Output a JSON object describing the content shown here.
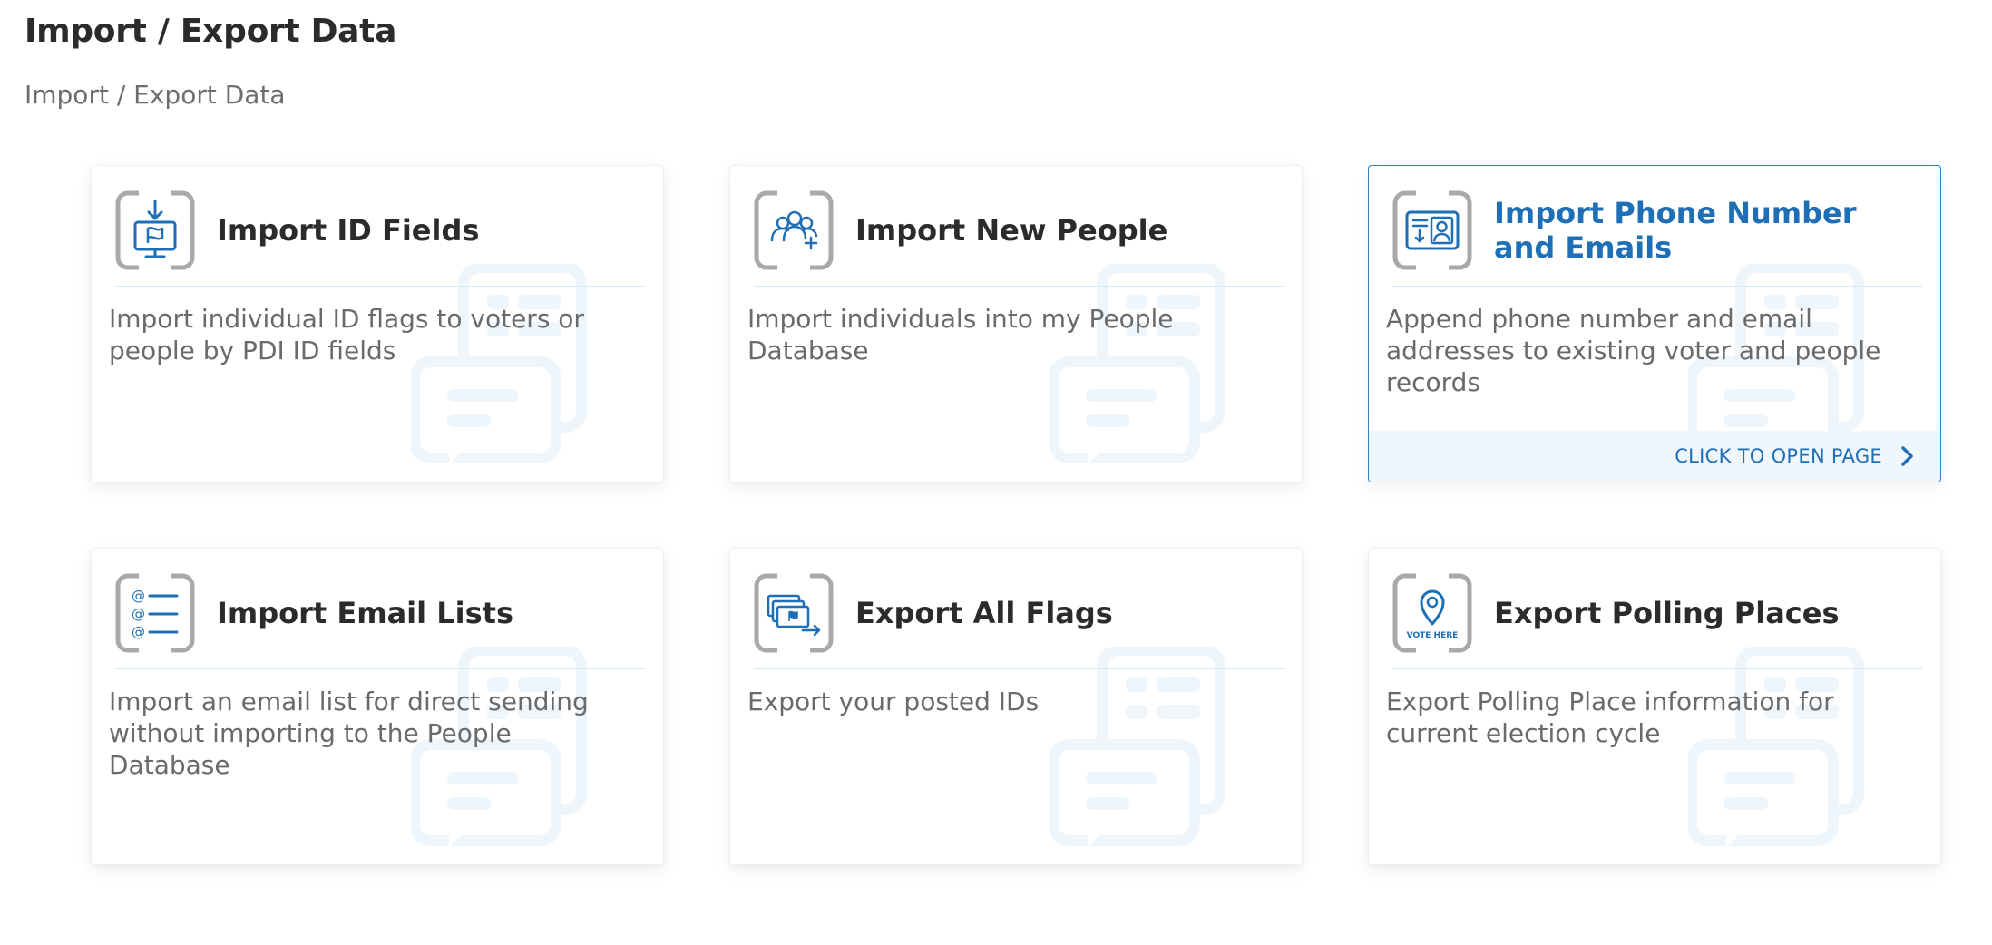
{
  "page": {
    "title": "Import / Export Data",
    "breadcrumb": "Import / Export Data"
  },
  "colors": {
    "accent": "#1f6fb7",
    "icon_frame": "#a9a9a9",
    "divider": "#d6e9f6",
    "watermark": "#f0f7fd"
  },
  "cards": [
    {
      "icon": "import-id-flag-icon",
      "title": "Import ID Fields",
      "description": "Import individual ID flags to voters or people by PDI ID fields"
    },
    {
      "icon": "people-add-icon",
      "title": "Import New People",
      "description": "Import individuals into my People Database"
    },
    {
      "icon": "contact-card-icon",
      "title": "Import Phone Number and Emails",
      "description": "Append phone number and email addresses to existing voter and people records",
      "footer": "CLICK TO OPEN PAGE",
      "active": true
    },
    {
      "icon": "email-list-icon",
      "title": "Import Email Lists",
      "description": "Import an email list for direct sending without importing to the People Database"
    },
    {
      "icon": "export-flags-icon",
      "title": "Export All Flags",
      "description": "Export your posted IDs"
    },
    {
      "icon": "polling-place-icon",
      "title": "Export Polling Places",
      "description": "Export Polling Place information for current election cycle",
      "icon_text": "VOTE HERE"
    }
  ]
}
